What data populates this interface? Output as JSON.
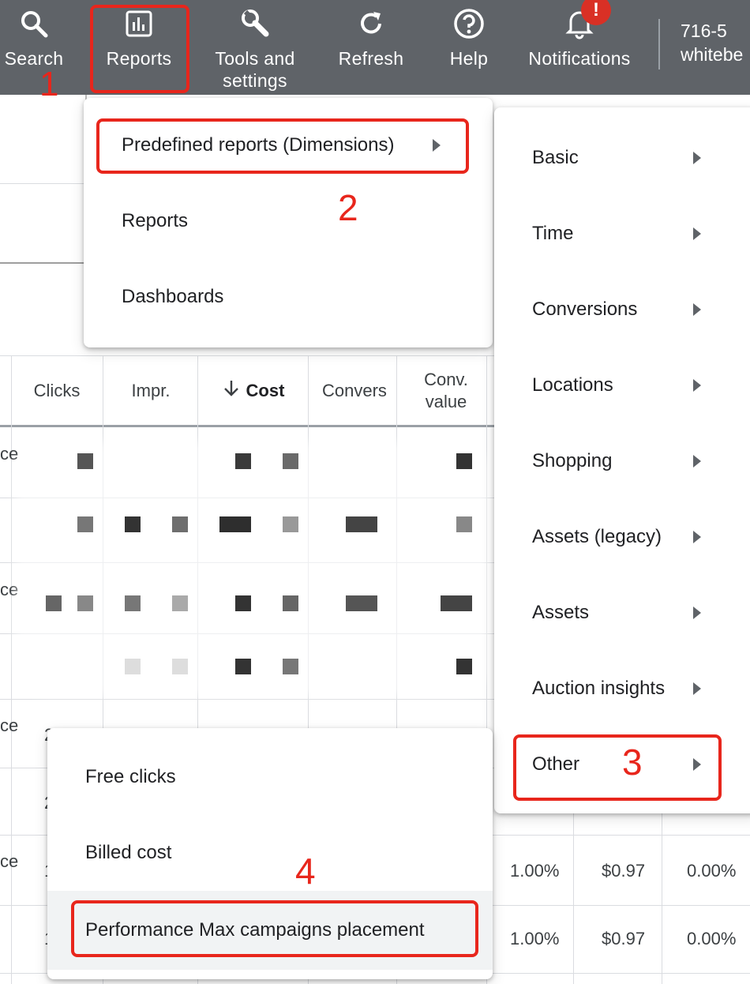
{
  "topbar": {
    "items": [
      {
        "label": "Search",
        "icon": "search-icon"
      },
      {
        "label": "Reports",
        "icon": "bar-chart-icon"
      },
      {
        "label": "Tools and settings",
        "icon": "wrench-icon"
      },
      {
        "label": "Refresh",
        "icon": "refresh-icon"
      },
      {
        "label": "Help",
        "icon": "help-icon"
      },
      {
        "label": "Notifications",
        "icon": "bell-icon"
      }
    ],
    "notification_badge": "!",
    "account_line1": "716-5",
    "account_line2": "whitebe"
  },
  "annotations": [
    "1",
    "2",
    "3",
    "4"
  ],
  "reports_menu": {
    "items": [
      "Predefined reports (Dimensions)",
      "Reports",
      "Dashboards"
    ]
  },
  "dimensions_menu": {
    "items": [
      "Basic",
      "Time",
      "Conversions",
      "Locations",
      "Shopping",
      "Assets (legacy)",
      "Assets",
      "Auction insights",
      "Other"
    ]
  },
  "other_menu": {
    "items": [
      "Free clicks",
      "Billed cost",
      "Performance Max campaigns placement"
    ]
  },
  "table": {
    "columns": [
      "Clicks",
      "Impr.",
      "Cost",
      "Convers",
      "Conv.\nvalue"
    ],
    "sorted_column_icon": "arrow-down-icon",
    "row_left_fragments": [
      "ce",
      "ce",
      "ce",
      "ce"
    ],
    "partial_digits": [
      "2",
      "2",
      "1",
      "1"
    ],
    "visible_rows": [
      {
        "rate": "1.00%",
        "cost": "$0.97",
        "pct": "0.00%"
      },
      {
        "rate": "1.00%",
        "cost": "$0.97",
        "pct": "0.00%"
      }
    ]
  },
  "colors": {
    "topbar": "#5f6368",
    "annotation_red": "#e8261c",
    "badge_red": "#d93025"
  }
}
